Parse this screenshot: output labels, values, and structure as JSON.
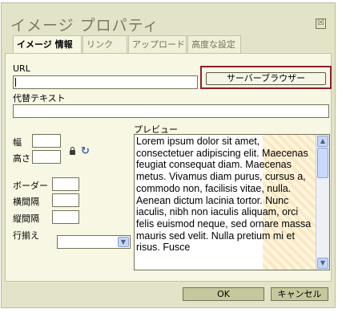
{
  "dialog": {
    "title": "イメージ プロパティ",
    "close_glyph": "☒"
  },
  "tabs": [
    {
      "label": "イメージ 情報",
      "active": true
    },
    {
      "label": "リンク",
      "active": false
    },
    {
      "label": "アップロード",
      "active": false
    },
    {
      "label": "高度な設定",
      "active": false
    }
  ],
  "form": {
    "url_label": "URL",
    "url_value": "",
    "browse_label": "サーバーブラウザー",
    "alt_label": "代替テキスト",
    "alt_value": "",
    "width_label": "幅",
    "height_label": "高さ",
    "border_label": "ボーダー",
    "hspace_label": "横間隔",
    "vspace_label": "縦間隔",
    "align_label": "行揃え",
    "align_value": "",
    "preview_label": "プレビュー",
    "preview_text": "Lorem ipsum dolor sit amet, consectetuer adipiscing elit. Maecenas feugiat consequat diam. Maecenas metus. Vivamus diam purus, cursus a, commodo non, facilisis vitae, nulla. Aenean dictum lacinia tortor. Nunc iaculis, nibh non iaculis aliquam, orci felis euismod neque, sed ornare massa mauris sed velit. Nulla pretium mi et risus. Fusce"
  },
  "footer": {
    "ok_label": "OK",
    "cancel_label": "キャンセル"
  },
  "colors": {
    "dialog_bg": "#e3e3c7",
    "panel_bg": "#f7f7e3",
    "highlight_border": "#8d1f2a"
  },
  "icons": {
    "lock": "lock-icon",
    "reset": "reset-size-icon"
  }
}
